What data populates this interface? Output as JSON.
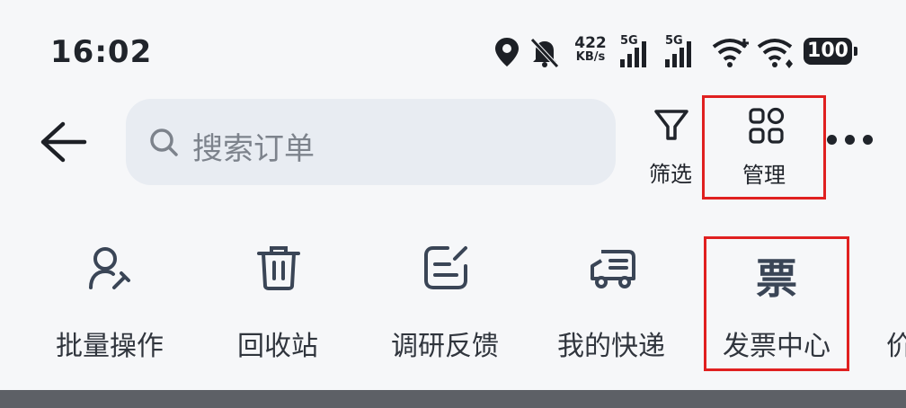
{
  "status_bar": {
    "time": "16:02",
    "net_speed_value": "422",
    "net_speed_unit": "KB/s",
    "sim1": "5G",
    "sim2": "5G",
    "battery": "100",
    "icons": [
      "location-icon",
      "mute-icon",
      "signal-icon",
      "wifi-plus-icon",
      "wifi-icon",
      "battery-icon"
    ]
  },
  "toolbar": {
    "search_placeholder": "搜索订单",
    "filter_label": "筛选",
    "manage_label": "管理"
  },
  "shortcuts": [
    {
      "label": "批量操作",
      "icon": "batch-user-icon"
    },
    {
      "label": "回收站",
      "icon": "trash-icon"
    },
    {
      "label": "调研反馈",
      "icon": "feedback-icon"
    },
    {
      "label": "我的快递",
      "icon": "truck-icon"
    },
    {
      "label": "发票中心",
      "icon": "invoice-icon",
      "glyph": "票"
    },
    {
      "label": "价"
    }
  ],
  "colors": {
    "highlight": "#e02020",
    "search_bg": "#e8ecf2",
    "icon": "#3a4556"
  }
}
